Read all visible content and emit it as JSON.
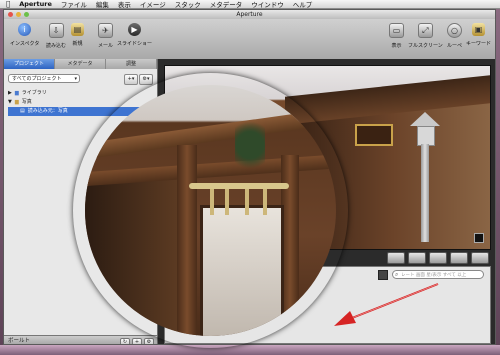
{
  "menubar": {
    "apple": "",
    "items": [
      "Aperture",
      "ファイル",
      "編集",
      "表示",
      "イメージ",
      "スタック",
      "メタデータ",
      "ウインドウ",
      "ヘルプ"
    ]
  },
  "window": {
    "title": "Aperture"
  },
  "toolbar": {
    "left": [
      {
        "label": "インスペクタ",
        "icon": "info-icon"
      },
      {
        "label": "読み込む",
        "icon": "import-icon"
      },
      {
        "label": "新規",
        "icon": "new-folder-icon"
      },
      {
        "label": "メール",
        "icon": "mail-icon"
      },
      {
        "label": "スライドショー",
        "icon": "play-icon"
      }
    ],
    "right": [
      {
        "label": "表示",
        "icon": "view-icon"
      },
      {
        "label": "フルスクリーン",
        "icon": "fullscreen-icon"
      },
      {
        "label": "ルーペ",
        "icon": "loupe-icon"
      },
      {
        "label": "キーワード",
        "icon": "keyword-icon"
      }
    ]
  },
  "sidebar": {
    "tabs": [
      "プロジェクト",
      "メタデータ",
      "調整"
    ],
    "active_tab": 0,
    "project_select": "すべてのプロジェクト",
    "tree": [
      {
        "label": "ライブラリ",
        "indent": 0,
        "selected": false
      },
      {
        "label": "写真",
        "indent": 0,
        "selected": false
      },
      {
        "label": "読み込み元：写真",
        "indent": 1,
        "selected": true
      }
    ],
    "footer_label": "ボールト"
  },
  "viewer": {
    "search_placeholder": "レート 画面 星/表示 すべて 以上",
    "loupe_zoom": "100"
  },
  "colors": {
    "selection": "#3e74d1",
    "arrow": "#d62424",
    "accent_tab": "#2e64c2"
  }
}
